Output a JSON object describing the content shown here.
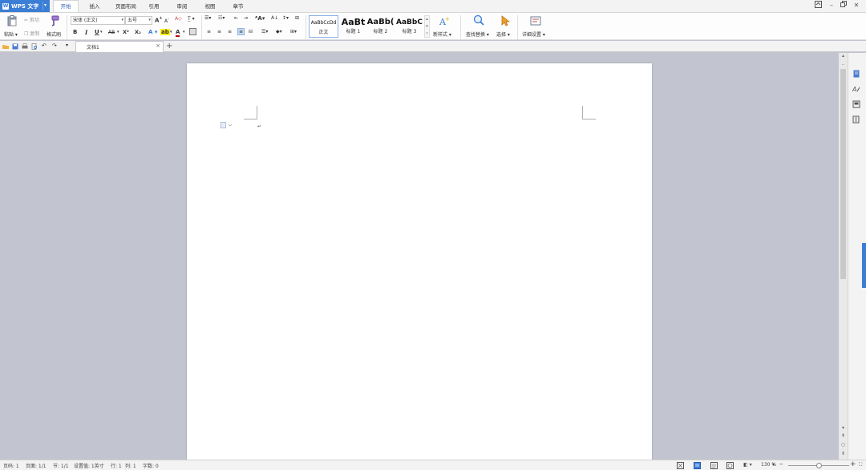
{
  "app": {
    "name": "WPS 文字"
  },
  "menu": {
    "tabs": [
      {
        "label": "开始",
        "active": true
      },
      {
        "label": "插入"
      },
      {
        "label": "页面布局"
      },
      {
        "label": "引用"
      },
      {
        "label": "审阅"
      },
      {
        "label": "视图"
      },
      {
        "label": "章节"
      }
    ]
  },
  "ribbon": {
    "paste": "粘贴",
    "cut": "剪切",
    "copy": "复制",
    "format_painter": "格式刷",
    "font_name": "宋体 (正文)",
    "font_size": "五号",
    "bold": "B",
    "italic": "I",
    "underline": "U",
    "strikethrough": "AB",
    "superscript": "X²",
    "subscript": "X₂",
    "styles": [
      {
        "preview": "AaBbCcDd",
        "label": "正文"
      },
      {
        "preview": "AaBt",
        "label": "标题 1"
      },
      {
        "preview": "AaBb(",
        "label": "标题 2"
      },
      {
        "preview": "AaBbC",
        "label": "标题 3"
      }
    ],
    "new_style": "新样式",
    "find_replace": "查找替换",
    "select": "选择",
    "detail_settings": "详细设置"
  },
  "doc_tab": {
    "title": "文档1"
  },
  "status": {
    "page": "页码: 1",
    "pages": "页面: 1/1",
    "section": "节: 1/1",
    "setting": "设置值: 1英寸",
    "row": "行: 1",
    "col": "列: 1",
    "words": "字数: 0",
    "zoom": "130 %"
  },
  "colors": {
    "accent": "#3b7ed6",
    "workspace": "#c2c5d0",
    "toolbar": "#f3f3f3"
  }
}
